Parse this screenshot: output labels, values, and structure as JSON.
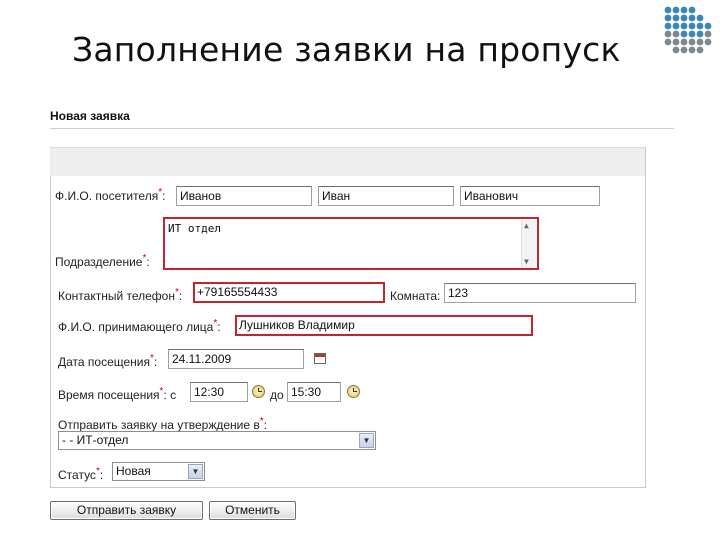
{
  "slide": {
    "title": "Заполнение заявки на пропуск"
  },
  "form": {
    "heading": "Новая заявка",
    "visitor": {
      "label": "Ф.И.О. посетителя",
      "required": "*",
      "suffix": ":",
      "last_name": "Иванов",
      "first_name": "Иван",
      "middle_name": "Иванович"
    },
    "department": {
      "label": "Подразделение",
      "required": "*",
      "suffix": ":",
      "value": "ИТ отдел"
    },
    "phone": {
      "label": "Контактный телефон",
      "required": "*",
      "suffix": ":",
      "value": "+79165554433"
    },
    "room": {
      "label": "Комната:",
      "value": "123"
    },
    "host": {
      "label": "Ф.И.О. принимающего лица",
      "required": "*",
      "suffix": ":",
      "value": "Лушников Владимир"
    },
    "visit_date": {
      "label": "Дата посещения",
      "required": "*",
      "suffix": ":",
      "value": "24.11.2009"
    },
    "visit_time": {
      "label": "Время посещения",
      "required": "*",
      "suffix": ": с",
      "from": "12:30",
      "to_label": "до",
      "to": "15:30"
    },
    "approval": {
      "label": "Отправить заявку на утверждение в",
      "required": "*",
      "suffix": ":",
      "selected": "- - ИТ-отдел"
    },
    "status": {
      "label": "Статус",
      "required": "*",
      "suffix": ":",
      "selected": "Новая"
    },
    "submit_label": "Отправить заявку",
    "cancel_label": "Отменить"
  },
  "colors": {
    "error_border": "#c0262d",
    "required_mark": "#cc0000",
    "logo_blue": "#3b86b8",
    "logo_gray": "#7d8790"
  },
  "icons": {
    "logo": "dot-grid-logo",
    "calendar": "calendar-icon",
    "clock": "clock-icon",
    "dropdown": "chevron-down-icon"
  }
}
